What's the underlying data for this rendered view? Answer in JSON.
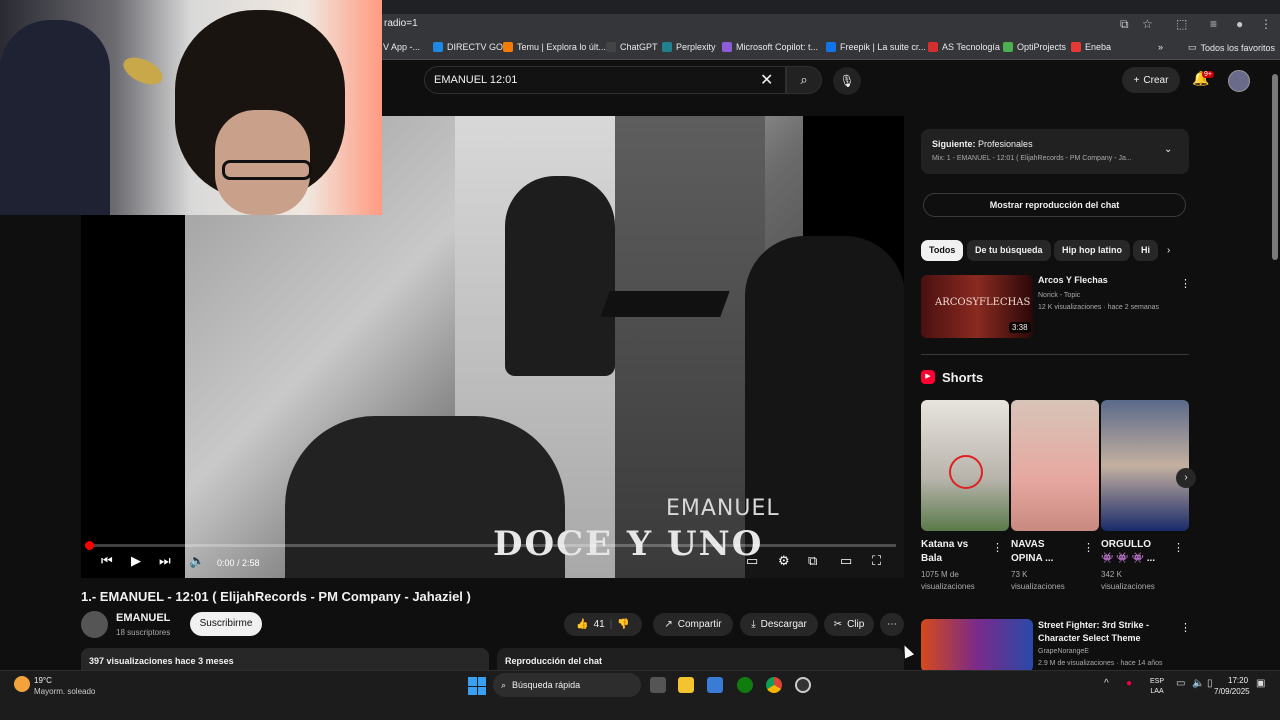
{
  "browser": {
    "url_fragment": "radio=1",
    "bookmarks": [
      {
        "label": "V App -...",
        "color": "#1a73e8"
      },
      {
        "label": "DIRECTV GO",
        "color": "#1e88e5"
      },
      {
        "label": "Temu | Explora lo últ...",
        "color": "#f57c00"
      },
      {
        "label": "ChatGPT",
        "color": "#444444"
      },
      {
        "label": "Perplexity",
        "color": "#20808d"
      },
      {
        "label": "Microsoft Copilot: t...",
        "color": "#8e5cd9"
      },
      {
        "label": "Freepik | La suite cr...",
        "color": "#1273eb"
      },
      {
        "label": "AS Tecnología",
        "color": "#d32f2f"
      },
      {
        "label": "OptiProjects",
        "color": "#4caf50"
      },
      {
        "label": "Eneba",
        "color": "#e53935"
      }
    ],
    "all_favorites": "Todos los favoritos"
  },
  "header": {
    "search_query": "EMANUEL 12:01",
    "create_label": "Crear",
    "notif_badge": "9+"
  },
  "player": {
    "watermark_name": "EMANUEL",
    "watermark_title": "DOCE Y UNO",
    "time": "0:00 / 2:58",
    "progress": 0.0
  },
  "video": {
    "title": "1.- EMANUEL - 12:01 ( ElijahRecords - PM Company - Jahaziel )",
    "channel": "EMANUEL",
    "subscribers": "18 suscriptores",
    "subscribe_label": "Suscribirme",
    "likes": "41",
    "share_label": "Compartir",
    "download_label": "Descargar",
    "clip_label": "Clip",
    "description_meta": "397 visualizaciones  hace 3 meses",
    "chat_replay": "Reproducción del chat"
  },
  "sidebar": {
    "next_label": "Siguiente:",
    "next_title": "Profesionales",
    "next_sub": "Mix: 1 - EMANUEL - 12:01 ( ElijahRecords - PM Company - Ja...",
    "show_chat": "Mostrar reproducción del chat",
    "chips": [
      "Todos",
      "De tu búsqueda",
      "Hip hop latino",
      "Hi"
    ],
    "rec": {
      "title": "Arcos Y Flechas",
      "channel": "Norick - Topic",
      "meta": "12 K visualizaciones · hace 2 semanas",
      "duration": "3:38",
      "thumb_text": "ARCOSYFLECHAS"
    },
    "shorts_label": "Shorts",
    "shorts": [
      {
        "title1": "Katana vs",
        "title2": "Bala",
        "views1": "1075 M de",
        "views2": "visualizaciones"
      },
      {
        "title1": "NAVAS",
        "title2": "OPINA ...",
        "views1": "73 K",
        "views2": "visualizaciones"
      },
      {
        "title1": "ORGULLO",
        "title2": "👾 👾 👾 ...",
        "views1": "342 K",
        "views2": "visualizaciones"
      }
    ],
    "sf": {
      "title": "Street Fighter: 3rd Strike - Character Select Theme",
      "channel": "GrapeNorangeE",
      "meta": "2.9 M de visualizaciones · hace 14 años"
    }
  },
  "taskbar": {
    "temp": "19°C",
    "weather": "Mayorm. soleado",
    "search_label": "Búsqueda rápida",
    "lang1": "ESP",
    "lang2": "LAA",
    "time": "17:20",
    "date": "7/09/2025"
  }
}
